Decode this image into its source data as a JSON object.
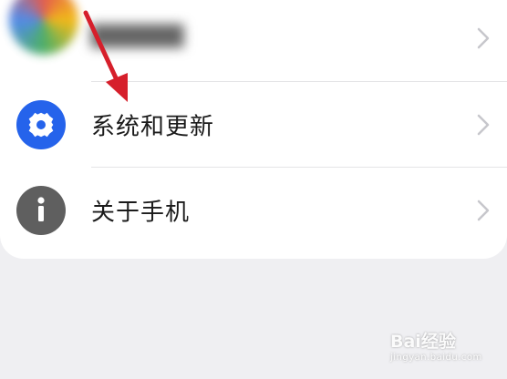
{
  "settings_list": {
    "items": [
      {
        "label": "",
        "icon": "account-avatar-icon",
        "blurred": true
      },
      {
        "label": "系统和更新",
        "icon": "gear-icon",
        "icon_color": "#2563eb"
      },
      {
        "label": "关于手机",
        "icon": "info-icon",
        "icon_color": "#5f5f5f"
      }
    ]
  },
  "annotation": {
    "arrow_color": "#d61f2b"
  },
  "watermark": {
    "brand": "Bai经验",
    "url": "jingyan.baidu.com"
  },
  "colors": {
    "background": "#efeff2",
    "card": "#ffffff",
    "text": "#1b1b1b",
    "chevron": "#c7c7cc"
  }
}
